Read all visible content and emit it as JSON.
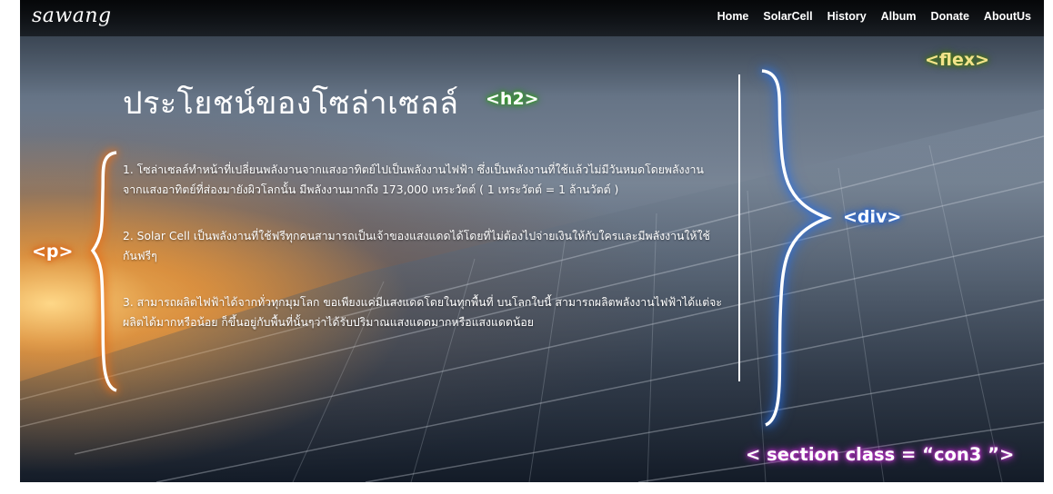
{
  "nav": {
    "logo": "sawang",
    "items": [
      "Home",
      "SolarCell",
      "History",
      "Album",
      "Donate",
      "AboutUs"
    ]
  },
  "section": {
    "title": "ประโยชน์ของโซล่าเซลล์",
    "paragraphs": [
      "1. โซล่าเซลล์ทำหน้าที่เปลี่ยนพลังงานจากแสงอาทิตย์ไปเป็นพลังงานไฟฟ้า ซึ่งเป็นพลังงานที่ใช้แล้วไม่มีวันหมดโดยพลังงานจากแสงอาทิตย์ที่ส่องมายังผิวโลกนั้น มีพลังงานมากถึง 173,000 เทระวัตต์ ( 1 เทระวัตต์ = 1 ล้านวัตต์ )",
      "2. Solar Cell เป็นพลังงานที่ใช้ฟรีทุกคนสามารถเป็นเจ้าของแสงแดดได้โดยที่ไม่ต้องไปจ่ายเงินให้กับใครและมีพลังงานให้ใช้กันฟรีๆ",
      "3. สามารถผลิตไฟฟ้าได้จากทั่วทุกมุมโลก ขอเพียงแค่มีแสงแดดโดยในทุกพื้นที่ บนโลกใบนี้ สามารถผลิตพลังงานไฟฟ้าได้แต่จะผลิตได้มากหรือน้อย ก็ขึ้นอยู่กับพื้นที่นั้นๆว่าได้รับปริมาณแสงแดดมากหรือแสงแดดน้อย"
    ]
  },
  "annotations": {
    "h2": "<h2>",
    "flex": "<flex>",
    "div": "<div>",
    "p": "<p>",
    "section": "< section class = “con3 ”>"
  },
  "colors": {
    "nav_background": "#000000",
    "text": "#ffffff",
    "tag_h2_glow": "#3aa52a",
    "tag_flex_glow": "#4f7c1c",
    "tag_div_glow": "#2a6fe0",
    "tag_p_glow": "#e4701c",
    "tag_section_glow": "#c53cd0"
  }
}
